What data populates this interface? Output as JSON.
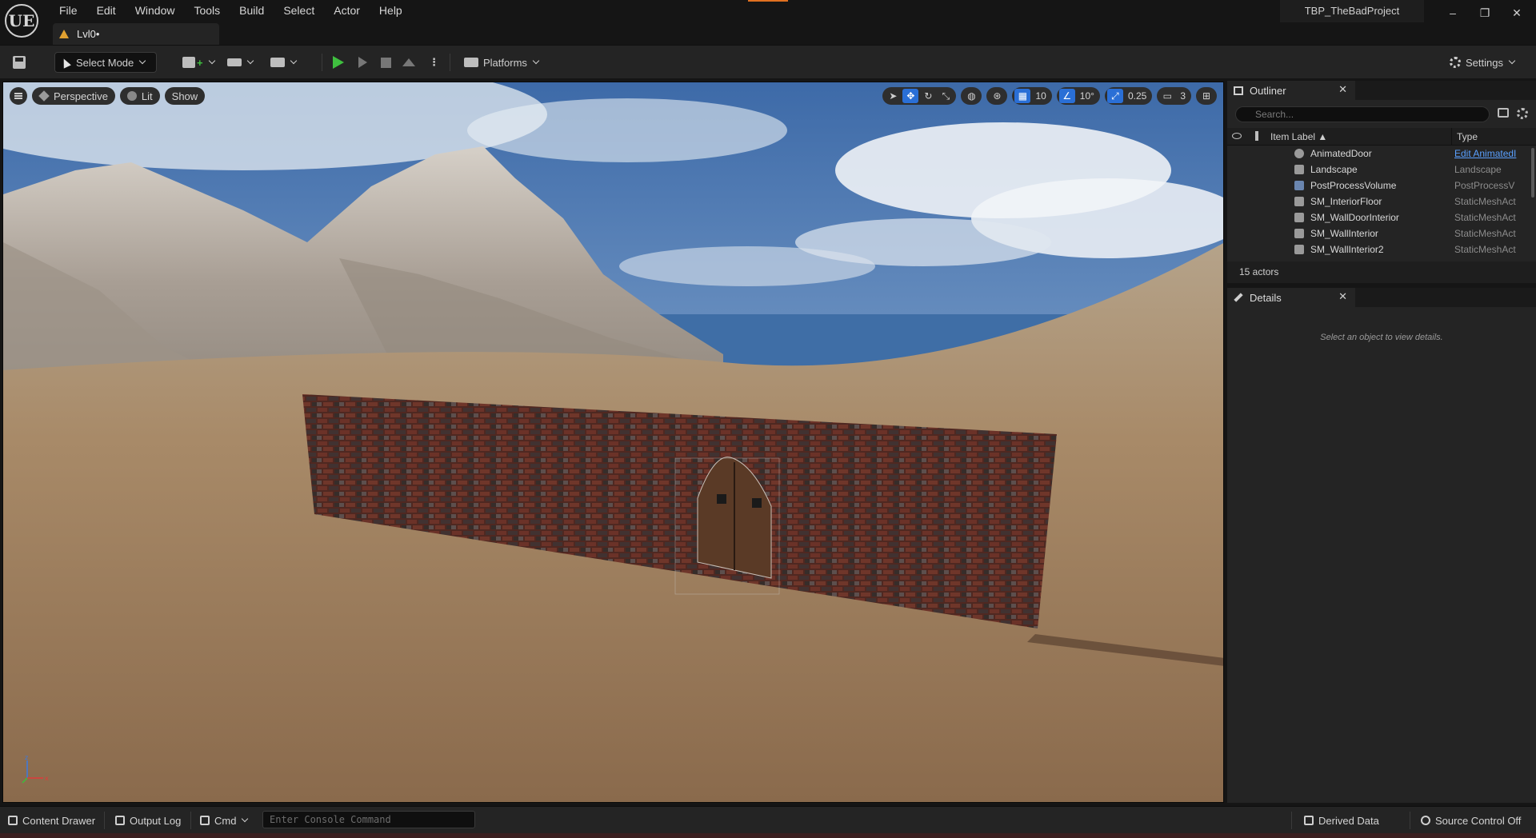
{
  "app": {
    "logo": "UE",
    "menu": [
      "File",
      "Edit",
      "Window",
      "Tools",
      "Build",
      "Select",
      "Actor",
      "Help"
    ],
    "level_tab": "Lvl0•",
    "project_name": "TBP_TheBadProject",
    "window_controls": [
      "–",
      "❐",
      "✕"
    ]
  },
  "toolbar": {
    "select_mode": "Select Mode",
    "platforms": "Platforms",
    "settings": "Settings"
  },
  "viewport": {
    "perspective": "Perspective",
    "lit": "Lit",
    "show": "Show",
    "grid_snap": "10",
    "rotation_snap": "10°",
    "scale_snap": "0.25",
    "camera_speed": "3"
  },
  "outliner": {
    "title": "Outliner",
    "search_placeholder": "Search...",
    "col_label": "Item Label ▲",
    "col_type": "Type",
    "rows": [
      {
        "name": "AnimatedDoor",
        "type": "Edit AnimatedI",
        "link": true
      },
      {
        "name": "Landscape",
        "type": "Landscape"
      },
      {
        "name": "PostProcessVolume",
        "type": "PostProcessV"
      },
      {
        "name": "SM_InteriorFloor",
        "type": "StaticMeshAct"
      },
      {
        "name": "SM_WallDoorInterior",
        "type": "StaticMeshAct"
      },
      {
        "name": "SM_WallInterior",
        "type": "StaticMeshAct"
      },
      {
        "name": "SM_WallInterior2",
        "type": "StaticMeshAct"
      }
    ],
    "actor_count": "15 actors"
  },
  "details": {
    "title": "Details",
    "empty_message": "Select an object to view details."
  },
  "statusbar": {
    "content_drawer": "Content Drawer",
    "output_log": "Output Log",
    "cmd": "Cmd",
    "console_placeholder": "Enter Console Command",
    "derived_data": "Derived Data",
    "source_control": "Source Control Off"
  },
  "colors": {
    "accent_blue": "#2a6fd6",
    "play_green": "#3fbf3f",
    "warning_orange": "#e0a030"
  }
}
